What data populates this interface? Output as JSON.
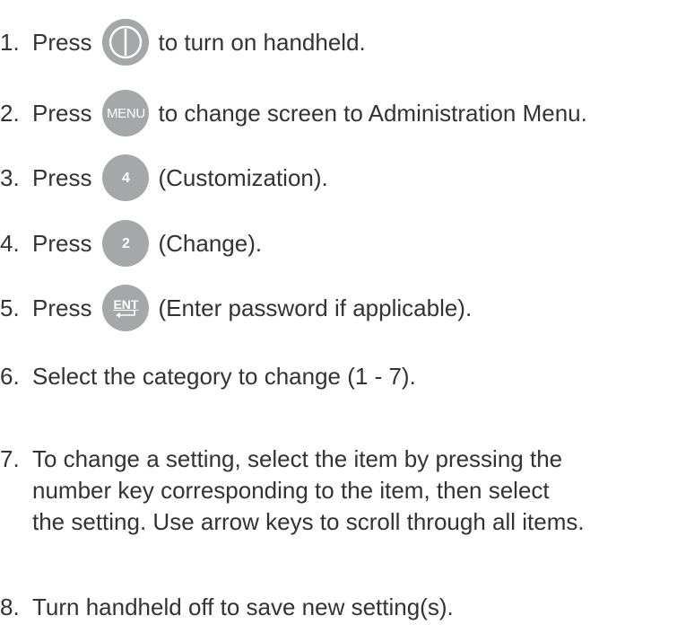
{
  "steps": [
    {
      "number": "1.",
      "lead": "Press",
      "key": {
        "type": "power",
        "icon": "power-icon"
      },
      "text": "to turn on handheld."
    },
    {
      "number": "2.",
      "lead": "Press",
      "key": {
        "type": "label",
        "label": "MENU"
      },
      "text": "to change screen to Administration Menu."
    },
    {
      "number": "3.",
      "lead": "Press",
      "key": {
        "type": "label",
        "label": "4"
      },
      "text": "(Customization)."
    },
    {
      "number": "4.",
      "lead": "Press",
      "key": {
        "type": "label",
        "label": "2"
      },
      "text": "(Change)."
    },
    {
      "number": "5.",
      "lead": "Press",
      "key": {
        "type": "label",
        "label": "ENT",
        "icon": "enter-arrow-icon"
      },
      "text": "(Enter password if applicable)."
    },
    {
      "number": "6.",
      "text": "Select the category to change (1 - 7)."
    },
    {
      "number": "7.",
      "lines": [
        "To change a setting, select the item by pressing the",
        "number key corresponding to the item, then select",
        "the setting. Use arrow keys to scroll through all items."
      ]
    },
    {
      "number": "8.",
      "text": "Turn handheld off to save new setting(s)."
    }
  ],
  "colors": {
    "key_fill": "#a6a7a9",
    "text": "#333333",
    "background": "#ffffff"
  }
}
